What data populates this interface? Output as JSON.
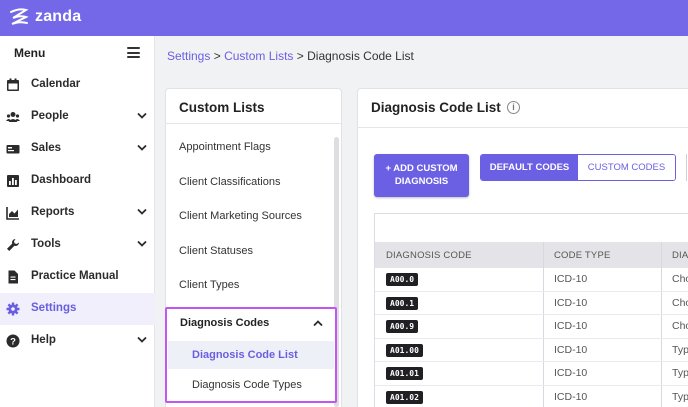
{
  "app": {
    "brand": "zanda"
  },
  "colors": {
    "brand": "#7468e8",
    "accent": "#6b5fe3",
    "highlight": "#c355f0"
  },
  "sidebar": {
    "title": "Menu",
    "items": [
      {
        "label": "Calendar",
        "icon": "calendar-icon",
        "has_children": false
      },
      {
        "label": "People",
        "icon": "people-icon",
        "has_children": true
      },
      {
        "label": "Sales",
        "icon": "sales-icon",
        "has_children": true
      },
      {
        "label": "Dashboard",
        "icon": "dashboard-icon",
        "has_children": false
      },
      {
        "label": "Reports",
        "icon": "reports-icon",
        "has_children": true
      },
      {
        "label": "Tools",
        "icon": "wrench-icon",
        "has_children": true
      },
      {
        "label": "Practice Manual",
        "icon": "document-icon",
        "has_children": false
      },
      {
        "label": "Settings",
        "icon": "gear-icon",
        "has_children": false,
        "active": true
      },
      {
        "label": "Help",
        "icon": "help-icon",
        "has_children": true
      }
    ]
  },
  "breadcrumb": {
    "settings": "Settings",
    "sep1": ">",
    "custom_lists": "Custom Lists",
    "sep2": ">",
    "current": "Diagnosis Code List"
  },
  "custom_lists": {
    "title": "Custom Lists",
    "items": [
      "Appointment Flags",
      "Client Classifications",
      "Client Marketing Sources",
      "Client Statuses",
      "Client Types"
    ],
    "group": {
      "label": "Diagnosis Codes",
      "expanded": true,
      "children": [
        {
          "label": "Diagnosis Code List",
          "active": true
        },
        {
          "label": "Diagnosis Code Types",
          "active": false
        }
      ]
    }
  },
  "main": {
    "title": "Diagnosis Code List",
    "add_button_line1": "+ ADD CUSTOM",
    "add_button_line2": "DIAGNOSIS",
    "tabs": [
      {
        "label": "DEFAULT CODES",
        "selected": true
      },
      {
        "label": "CUSTOM CODES",
        "selected": false
      }
    ],
    "table": {
      "columns": [
        "DIAGNOSIS CODE",
        "CODE TYPE",
        "DIA"
      ],
      "rows": [
        {
          "code": "A00.0",
          "type": "ICD-10",
          "desc": "Cho"
        },
        {
          "code": "A00.1",
          "type": "ICD-10",
          "desc": "Cho"
        },
        {
          "code": "A00.9",
          "type": "ICD-10",
          "desc": "Cho"
        },
        {
          "code": "A01.00",
          "type": "ICD-10",
          "desc": "Typ"
        },
        {
          "code": "A01.01",
          "type": "ICD-10",
          "desc": "Typ"
        },
        {
          "code": "A01.02",
          "type": "ICD-10",
          "desc": "Typ"
        }
      ]
    }
  }
}
